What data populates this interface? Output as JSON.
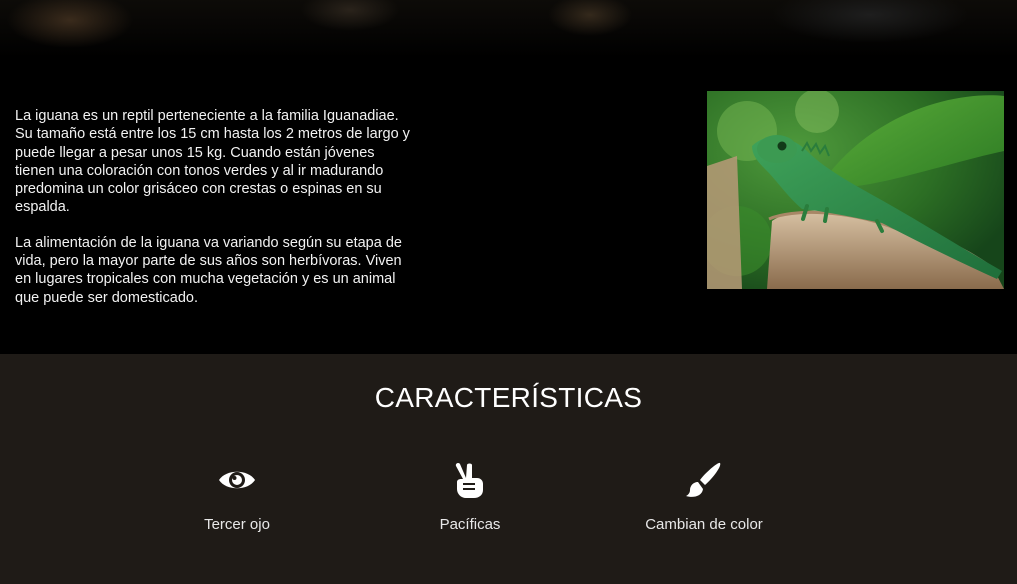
{
  "about": {
    "paragraphs": [
      "La iguana es un reptil perteneciente a la familia Iguanadiae. Su tamaño está entre los 15 cm hasta los 2 metros de largo y puede llegar a pesar unos 15 kg. Cuando están jóvenes tienen una coloración con tonos verdes y al ir madurando predomina un color grisáceo con crestas o espinas en su espalda.",
      "La alimentación de la iguana va variando según su etapa de vida, pero la mayor parte de sus años son herbívoras. Viven en lugares tropicales con mucha vegetación y es un animal que puede ser domesticado."
    ],
    "photo_alt": "iguana"
  },
  "features": {
    "title": "CARACTERÍSTICAS",
    "items": [
      {
        "icon": "eye-icon",
        "label": "Tercer ojo"
      },
      {
        "icon": "peace-hand-icon",
        "label": "Pacíficas"
      },
      {
        "icon": "paint-brush-icon",
        "label": "Cambian de color"
      }
    ]
  },
  "colors": {
    "background": "#000000",
    "features_background": "#1f1b17",
    "text": "#ffffff"
  }
}
